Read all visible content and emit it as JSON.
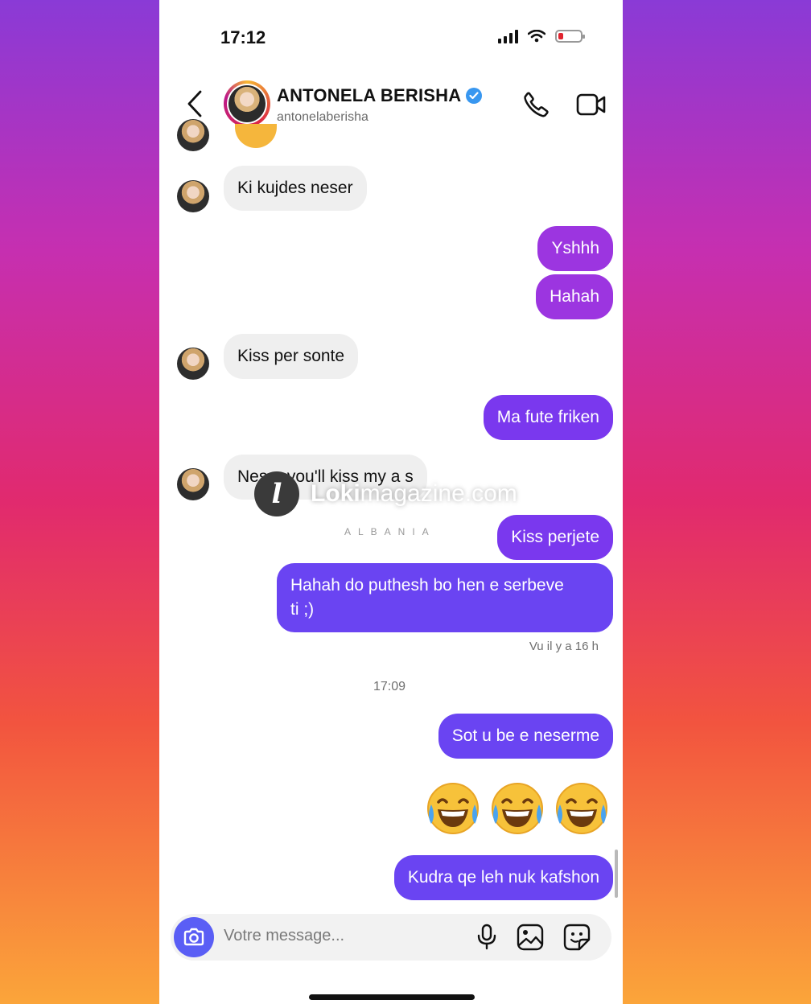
{
  "status": {
    "time": "17:12"
  },
  "header": {
    "name": "ANTONELA BERISHA",
    "username": "antonelaberisha"
  },
  "messages": {
    "m1": "Ki kujdes neser",
    "m2": "Yshhh",
    "m3": "Hahah",
    "m4": "Kiss per sonte",
    "m5": "Ma fute friken",
    "m6": "Neser you'll kiss my a s",
    "m7": "Kiss perjete",
    "m8_line1": "Hahah do puthesh bo hen e serbeve",
    "m8_line2": "ti ;)",
    "seen": "Vu il y a 16 h",
    "timestamp": "17:09",
    "m9": "Sot u be e neserme",
    "m10": "Kudra qe leh nuk kafshon"
  },
  "watermark": {
    "bold": "Loki",
    "rest": "magazine.com",
    "sub": "ALBANIA"
  },
  "composer": {
    "placeholder": "Votre message..."
  },
  "colors": {
    "bubble_in": "#efefef",
    "bubble_out_1": "#9c35e0",
    "bubble_out_2": "#7a38ee",
    "bubble_out_3": "#6a44f2",
    "camera_button": "#5a5ef5"
  },
  "icons": [
    "back-arrow-icon",
    "verified-badge-icon",
    "phone-call-icon",
    "video-call-icon",
    "camera-icon",
    "microphone-icon",
    "gallery-icon",
    "sticker-icon",
    "laughing-emoji-icon"
  ]
}
